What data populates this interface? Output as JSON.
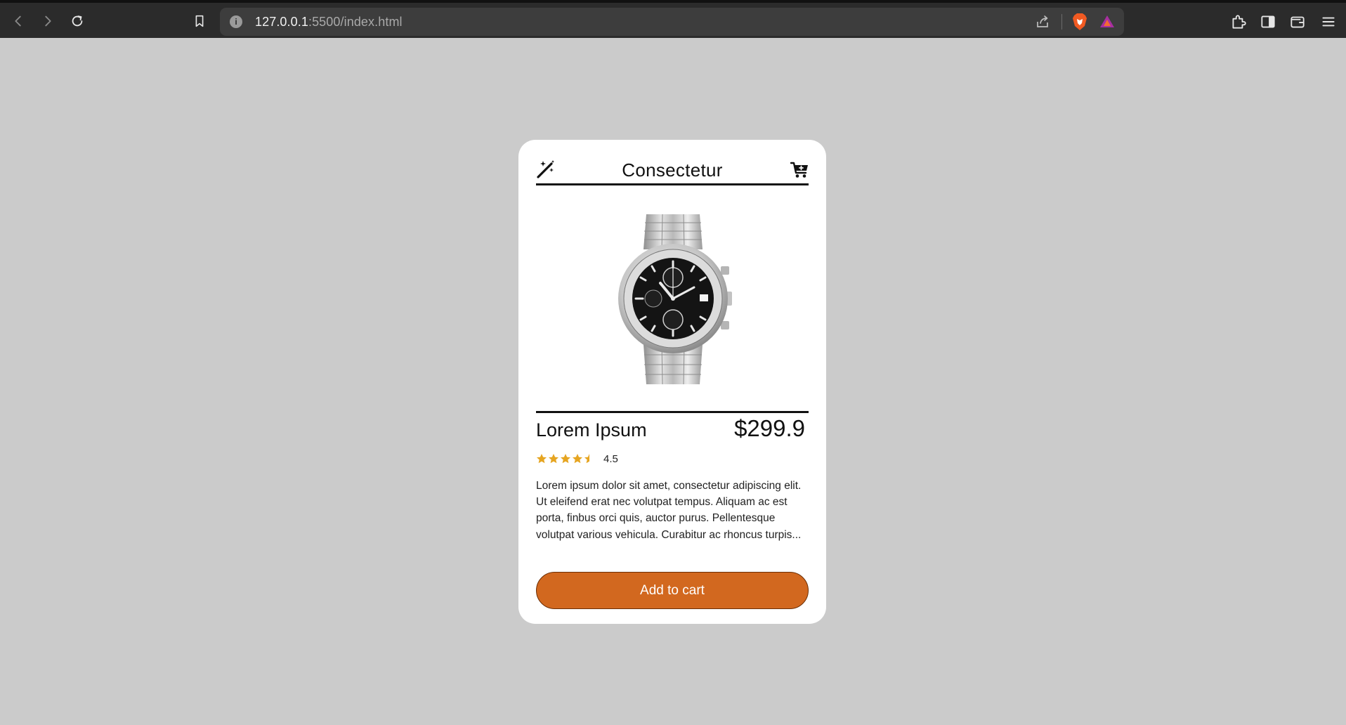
{
  "browser": {
    "url_host": "127.0.0.1",
    "url_path": ":5500/index.html",
    "icons": [
      "back-icon",
      "forward-icon",
      "reload-icon",
      "bookmark-icon",
      "site-info-icon",
      "share-icon",
      "brave-shields-icon",
      "brave-rewards-icon",
      "extensions-icon",
      "sidebar-icon",
      "wallet-icon",
      "menu-icon"
    ]
  },
  "card": {
    "title": "Consectetur",
    "product_name": "Lorem Ipsum",
    "price": "$299.9",
    "rating_value": "4.5",
    "rating": 4.5,
    "rating_max": 5,
    "description": "Lorem ipsum dolor sit amet, consectetur adipiscing elit. Ut eleifend erat nec volutpat tempus. Aliquam ac est porta, finbus orci quis, auctor purus. Pellentesque volutpat various vehicula. Curabitur ac rhoncus turpis...",
    "button_label": "Add to cart"
  },
  "colors": {
    "page_bg": "#cbcbcb",
    "card_bg": "#ffffff",
    "accent": "#d2681f",
    "star": "#e6a521",
    "chrome_bg": "#2b2b2b"
  }
}
